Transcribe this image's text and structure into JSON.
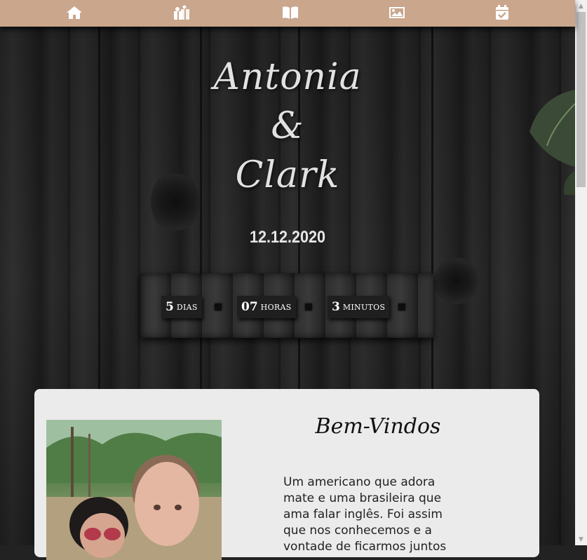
{
  "nav": {
    "items": [
      {
        "icon": "home-icon"
      },
      {
        "icon": "gifts-icon"
      },
      {
        "icon": "book-icon"
      },
      {
        "icon": "image-icon"
      },
      {
        "icon": "calendar-check-icon"
      }
    ],
    "background": "#c9a68c"
  },
  "hero": {
    "name1": "Antonia",
    "amp": "&",
    "name2": "Clark",
    "date": "12.12.2020"
  },
  "countdown": {
    "days_value": "5",
    "days_label": "dias",
    "hours_value": "07",
    "hours_label": "horas",
    "minutes_value": "3",
    "minutes_label": "minutos"
  },
  "welcome": {
    "title": "Bem-Vindos",
    "text": "Um americano que adora mate e uma brasileira que ama falar inglês. Foi assim que nos conhecemos e a vontade de ficarmos juntos"
  }
}
